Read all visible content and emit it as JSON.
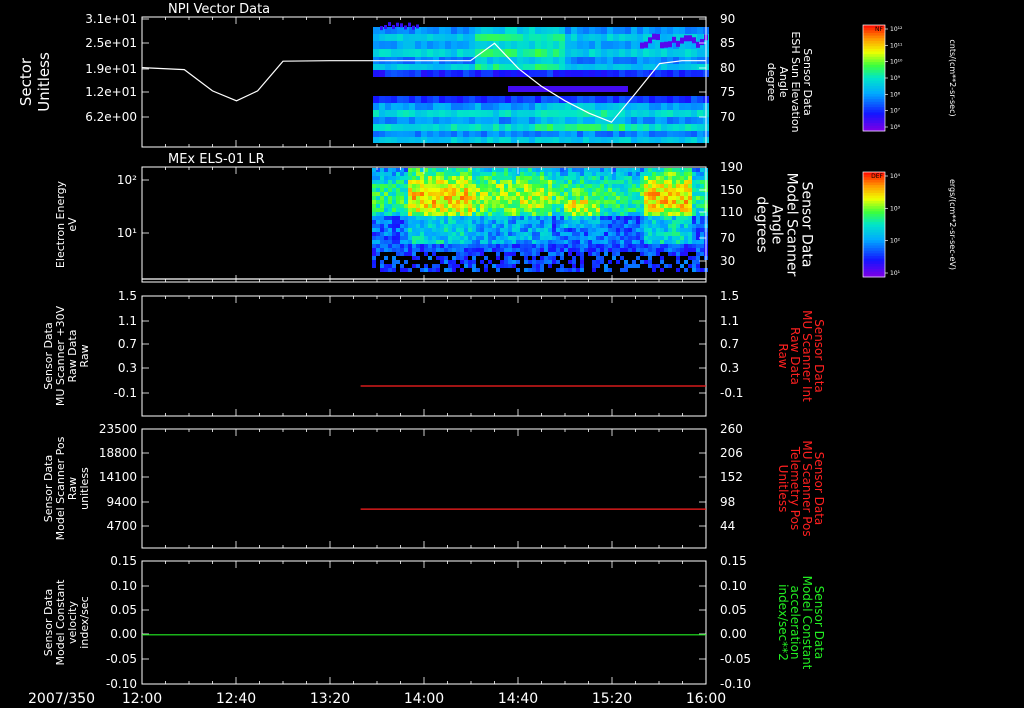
{
  "date_label": "2007/350",
  "x_ticks": [
    "12:00",
    "12:40",
    "13:20",
    "14:00",
    "14:40",
    "15:20",
    "16:00"
  ],
  "colorbars": [
    {
      "tag": "NF",
      "title": "cnts/(cm**2-sr-sec)",
      "ticks": [
        "10¹²",
        "10¹¹",
        "10¹⁰",
        "10⁹",
        "10⁸",
        "10⁷",
        "10⁶"
      ]
    },
    {
      "tag": "DEF",
      "title": "ergs/(cm**2-sr-sec-eV)",
      "ticks": [
        "10⁴",
        "10³",
        "10²",
        "10¹"
      ]
    }
  ],
  "colors": {
    "white": "#ffffff",
    "red": "#ff2020",
    "green": "#22ee22"
  },
  "chart_data": [
    {
      "type": "heatmap",
      "title": "NPI Vector Data",
      "ylabel_lines": [
        "Sector",
        "Unitless"
      ],
      "yticks": [
        "3.1e+01",
        "2.5e+01",
        "1.9e+01",
        "1.2e+01",
        "6.2e+00"
      ],
      "ylabel2_lines": [
        "Sensor Data",
        "ESH Sun Elevation",
        "Angle",
        "degree"
      ],
      "yticks2": [
        "90",
        "85",
        "80",
        "75",
        "70"
      ],
      "ylim2": [
        65,
        90
      ],
      "overlay_series": {
        "color": "white",
        "x_hours": [
          12.0,
          12.3,
          12.5,
          12.67,
          12.82,
          13.0,
          13.33,
          13.67,
          14.0,
          14.33,
          14.5,
          14.67,
          14.83,
          15.0,
          15.17,
          15.33,
          15.5,
          15.67,
          15.83,
          16.0
        ],
        "values": [
          80.2,
          79.8,
          75.5,
          73.5,
          75.5,
          81.5,
          81.6,
          81.6,
          81.6,
          81.6,
          85.1,
          80.0,
          76.5,
          73.5,
          71.0,
          69.2,
          75.0,
          81.0,
          81.6,
          81.6
        ]
      }
    },
    {
      "type": "heatmap",
      "title": "MEx ELS-01 LR",
      "ylabel_lines": [
        "Electron Energy",
        "eV"
      ],
      "yticks": [
        "10²",
        "10¹"
      ],
      "ylabel2_lines": [
        "Sensor Data",
        "Model Scanner",
        "Angle",
        "degrees"
      ],
      "yticks2": [
        "190",
        "150",
        "110",
        "70",
        "30"
      ],
      "ylim2": [
        0,
        190
      ],
      "overlay_series": {
        "color": "white",
        "x_hours": [
          12.0,
          16.0
        ],
        "values": [
          5,
          5
        ]
      }
    },
    {
      "type": "line",
      "ylabel_lines": [
        "Sensor Data",
        "MU Scanner +30V",
        "Raw Data",
        "Raw"
      ],
      "yticks": [
        "1.5",
        "1.1",
        "0.7",
        "0.3",
        "-0.1"
      ],
      "ylim": [
        -0.5,
        1.5
      ],
      "ylabel2_lines": [
        "Sensor Data",
        "MU Scanner Int",
        "Raw Data",
        "Raw"
      ],
      "yticks2": [
        "1.5",
        "1.1",
        "0.7",
        "0.3",
        "-0.1"
      ],
      "series": [
        {
          "color": "red",
          "x_hours": [
            13.55,
            16.0
          ],
          "values": [
            0.0,
            0.0
          ]
        }
      ]
    },
    {
      "type": "line",
      "ylabel_lines": [
        "Sensor Data",
        "Model Scanner Pos",
        "Raw",
        "unitless"
      ],
      "yticks": [
        "23500",
        "18800",
        "14100",
        "9400",
        "4700"
      ],
      "ylim": [
        0,
        23500
      ],
      "ylabel2_lines": [
        "Sensor Data",
        "MU Scanner Pos",
        "Telemetry Pos",
        "Unitless"
      ],
      "yticks2": [
        "260",
        "206",
        "152",
        "98",
        "44"
      ],
      "ylim2": [
        0,
        260
      ],
      "series": [
        {
          "color": "red",
          "x_hours": [
            13.55,
            16.0
          ],
          "values2": [
            85,
            85
          ]
        }
      ]
    },
    {
      "type": "line",
      "ylabel_lines": [
        "Sensor Data",
        "Model Constant",
        "velocity",
        "index/sec"
      ],
      "yticks": [
        "0.15",
        "0.10",
        "0.05",
        "0.00",
        "-0.05",
        "-0.10"
      ],
      "ylim": [
        -0.1,
        0.15
      ],
      "ylabel2_lines": [
        "Sensor Data",
        "Model Constant",
        "acceleration",
        "index/sec**2"
      ],
      "yticks2": [
        "0.15",
        "0.10",
        "0.05",
        "0.00",
        "-0.05",
        "-0.10"
      ],
      "series": [
        {
          "color": "green",
          "x_hours": [
            12.0,
            16.0
          ],
          "values": [
            0.0,
            0.0
          ]
        }
      ]
    }
  ]
}
